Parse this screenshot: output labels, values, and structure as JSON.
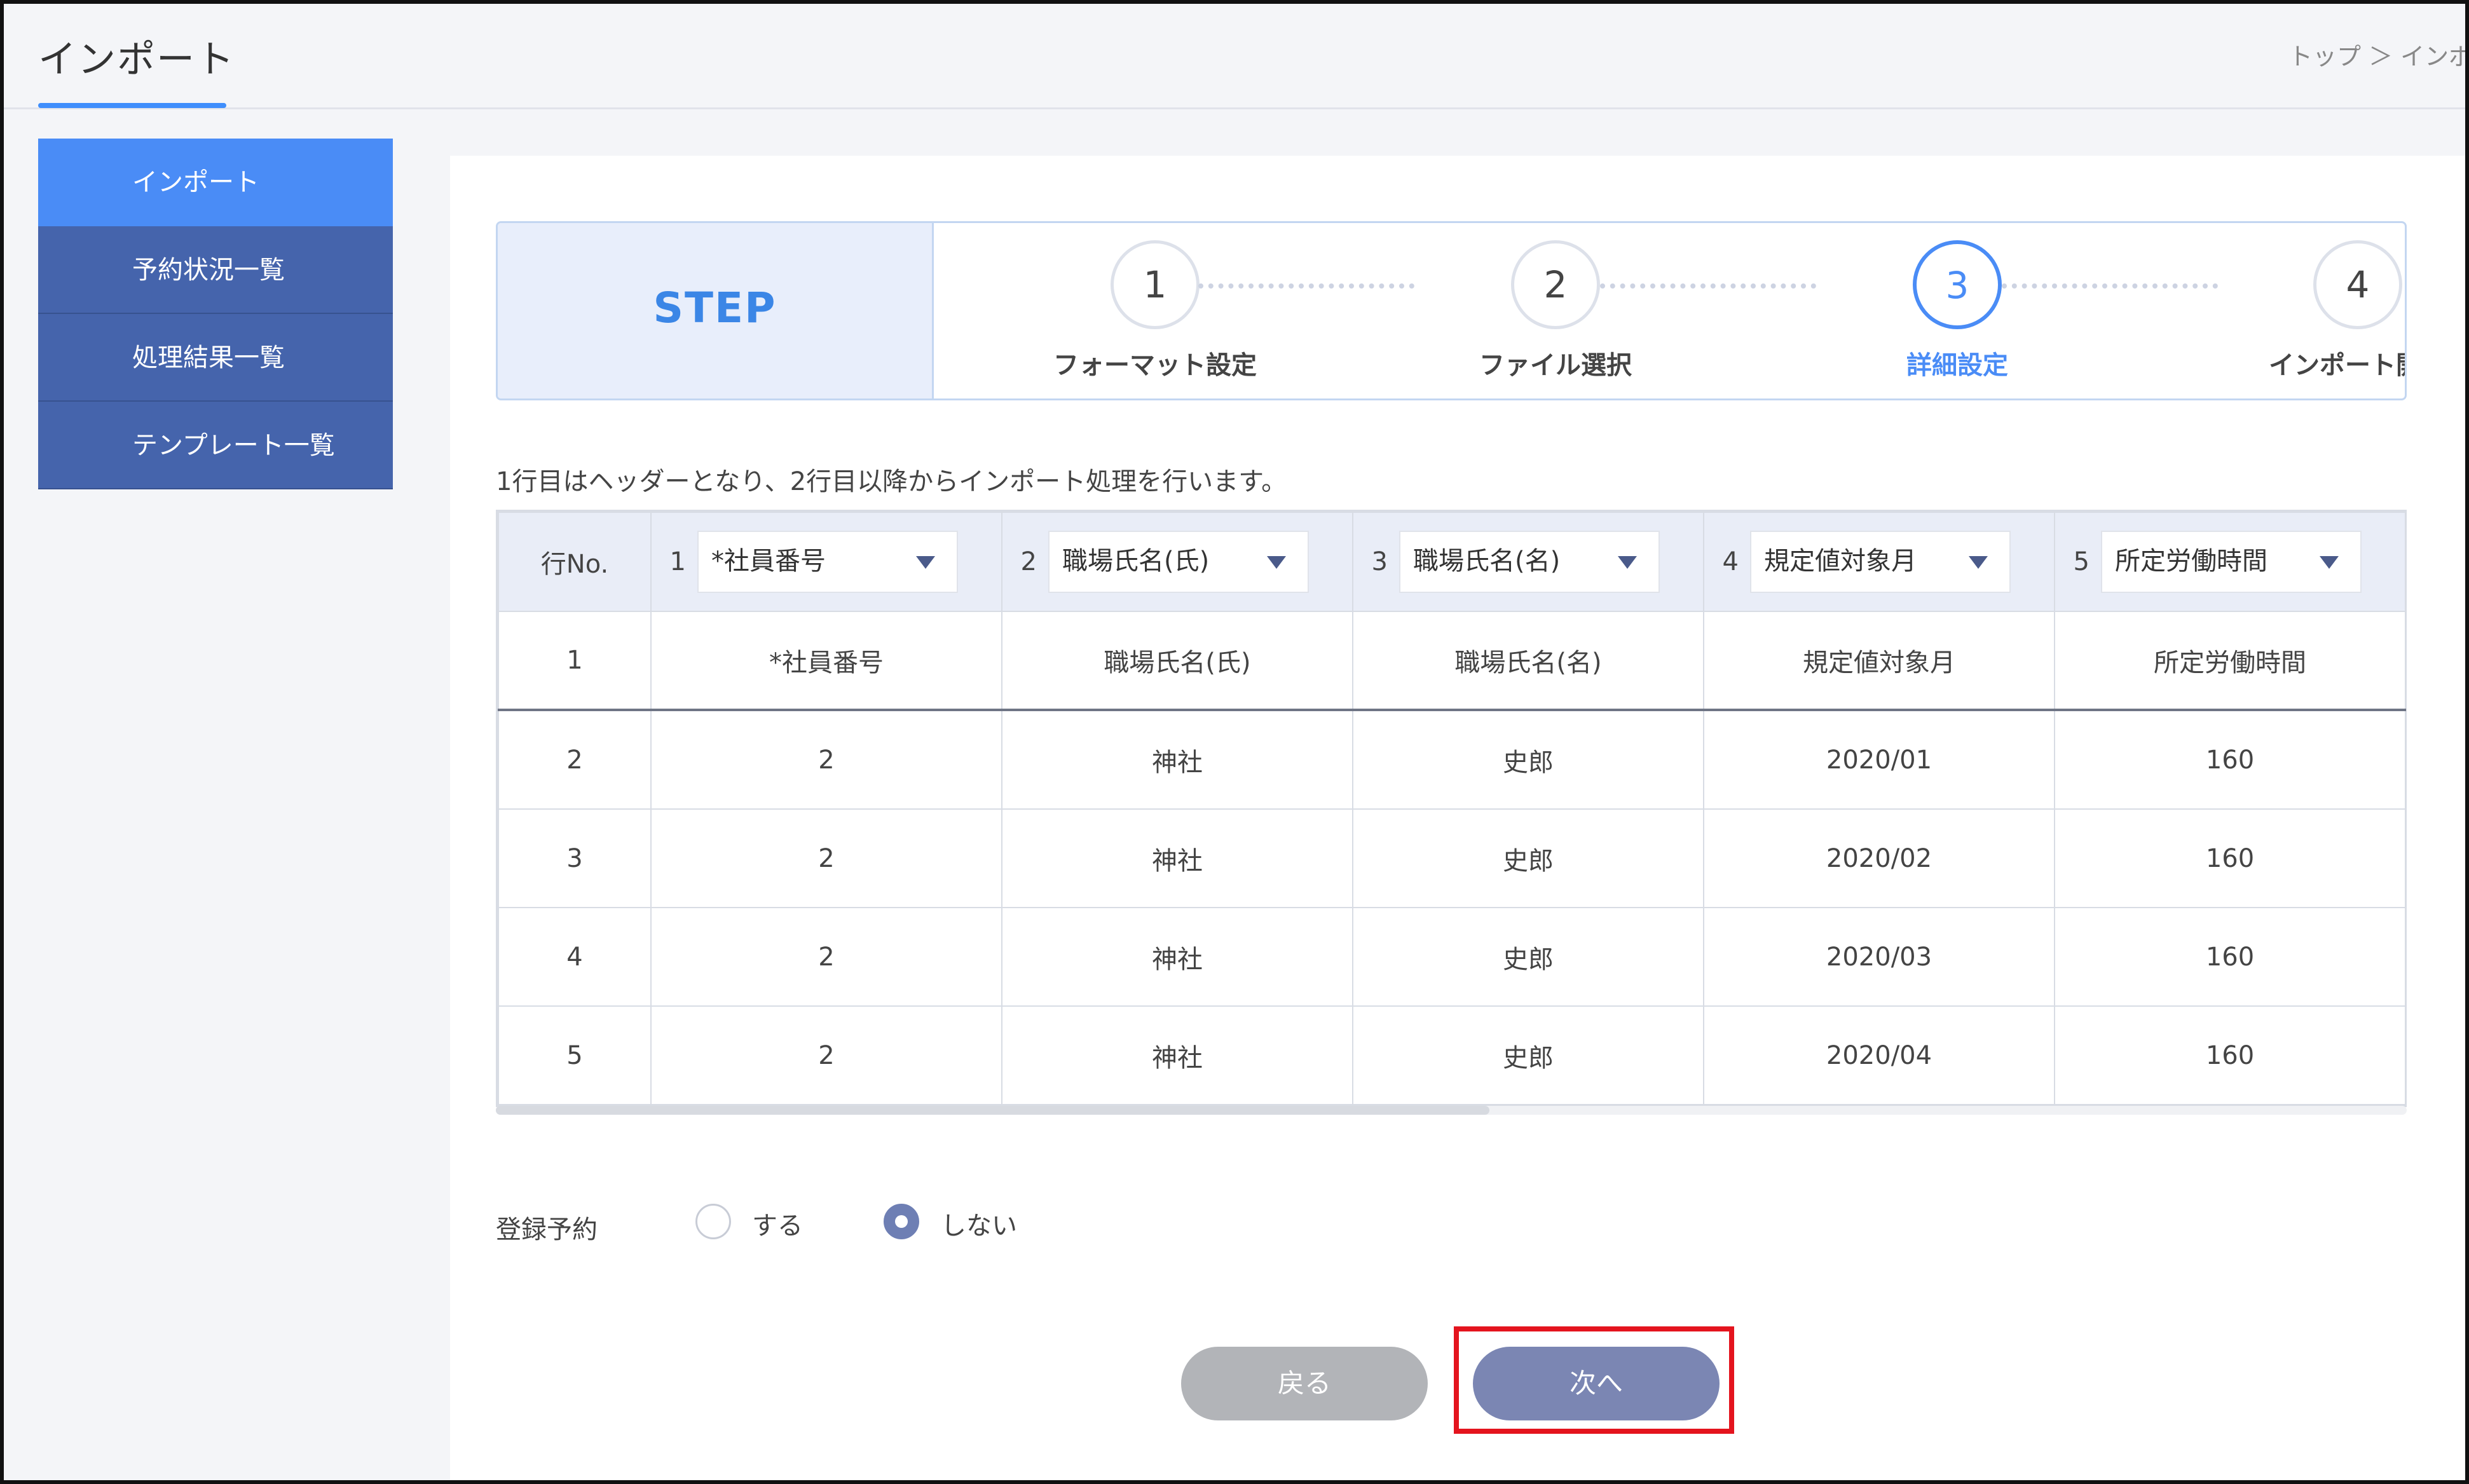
{
  "page": {
    "title": "インポート",
    "breadcrumb": "トップ ＞ インポ"
  },
  "sidebar": {
    "items": [
      {
        "label": "インポート",
        "active": true
      },
      {
        "label": "予約状況一覧",
        "active": false
      },
      {
        "label": "処理結果一覧",
        "active": false
      },
      {
        "label": "テンプレート一覧",
        "active": false
      }
    ]
  },
  "stepbar": {
    "label": "STEP",
    "steps": [
      {
        "number": "1",
        "name": "フォーマット設定"
      },
      {
        "number": "2",
        "name": "ファイル選択"
      },
      {
        "number": "3",
        "name": "詳細設定"
      },
      {
        "number": "4",
        "name": "インポート開始"
      }
    ],
    "current_step": 3
  },
  "description": "1行目はヘッダーとなり、2行目以降からインポート処理を行います。",
  "table": {
    "rowno_header": "行No.",
    "columns": [
      {
        "num": "1",
        "selected": "*社員番号"
      },
      {
        "num": "2",
        "selected": "職場氏名(氏)"
      },
      {
        "num": "3",
        "selected": "職場氏名(名)"
      },
      {
        "num": "4",
        "selected": "規定値対象月"
      },
      {
        "num": "5",
        "selected": "所定労働時間"
      }
    ],
    "rows": [
      {
        "no": "1",
        "cells": [
          "*社員番号",
          "職場氏名(氏)",
          "職場氏名(名)",
          "規定値対象月",
          "所定労働時間"
        ]
      },
      {
        "no": "2",
        "cells": [
          "2",
          "神社",
          "史郎",
          "2020/01",
          "160"
        ]
      },
      {
        "no": "3",
        "cells": [
          "2",
          "神社",
          "史郎",
          "2020/02",
          "160"
        ]
      },
      {
        "no": "4",
        "cells": [
          "2",
          "神社",
          "史郎",
          "2020/03",
          "160"
        ]
      },
      {
        "no": "5",
        "cells": [
          "2",
          "神社",
          "史郎",
          "2020/04",
          "160"
        ]
      }
    ],
    "scroll_fraction": 0.52
  },
  "registration": {
    "label": "登録予約",
    "options": [
      {
        "label": "する",
        "checked": false
      },
      {
        "label": "しない",
        "checked": true
      }
    ]
  },
  "buttons": {
    "back": "戻る",
    "next": "次へ"
  },
  "colors": {
    "accent": "#4a8cf6",
    "sidebar": "#4564ac",
    "next_button": "#7b86b3",
    "back_button": "#b2b4b8",
    "highlight": "#e4141e"
  }
}
